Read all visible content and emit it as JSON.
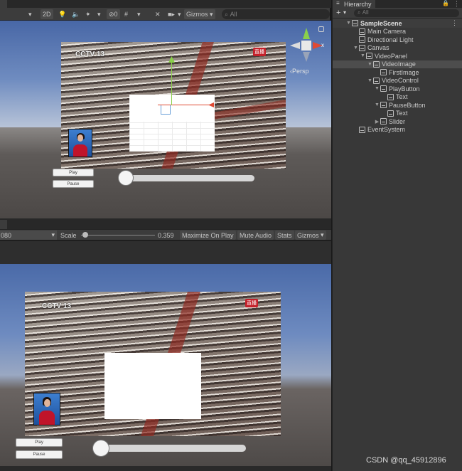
{
  "scene_toolbar": {
    "mode_2d": "2D",
    "hidden_count": "0",
    "gizmos": "Gizmos",
    "search_placeholder": "All"
  },
  "scene_view": {
    "persp_label": "‹Persp",
    "gizmo_axis_x": "x"
  },
  "video": {
    "channel_logo": "CCTV 13",
    "live_badge": "直播"
  },
  "controls": {
    "play_label": "Play",
    "pause_label": "Pause"
  },
  "game_toolbar": {
    "resolution_value": "080",
    "scale_label": "Scale",
    "scale_value": "0.359",
    "scale_level": 0.06,
    "maximize_on_play": "Maximize On Play",
    "mute_audio": "Mute Audio",
    "stats": "Stats",
    "gizmos": "Gizmos"
  },
  "hierarchy": {
    "tab_label": "Hierarchy",
    "search_placeholder": "All",
    "items": [
      {
        "label": "SampleScene",
        "depth": 0,
        "arrow": "▼",
        "bold": true
      },
      {
        "label": "Main Camera",
        "depth": 1,
        "arrow": ""
      },
      {
        "label": "Directional Light",
        "depth": 1,
        "arrow": ""
      },
      {
        "label": "Canvas",
        "depth": 1,
        "arrow": "▼"
      },
      {
        "label": "VideoPanel",
        "depth": 2,
        "arrow": "▼"
      },
      {
        "label": "VideoImage",
        "depth": 3,
        "arrow": "▼",
        "selected": true
      },
      {
        "label": "FirstImage",
        "depth": 4,
        "arrow": ""
      },
      {
        "label": "VideoControl",
        "depth": 3,
        "arrow": "▼"
      },
      {
        "label": "PlayButton",
        "depth": 4,
        "arrow": "▼"
      },
      {
        "label": "Text",
        "depth": 5,
        "arrow": ""
      },
      {
        "label": "PauseButton",
        "depth": 4,
        "arrow": "▼"
      },
      {
        "label": "Text",
        "depth": 5,
        "arrow": ""
      },
      {
        "label": "Slider",
        "depth": 4,
        "arrow": "▶"
      },
      {
        "label": "EventSystem",
        "depth": 1,
        "arrow": ""
      }
    ]
  },
  "watermark": "CSDN @qq_45912896",
  "colors": {
    "editor_bg": "#383838",
    "sky_top": "#4a6aa8",
    "ground": "#5c5856",
    "live_red": "#c4202a",
    "gizmo_x": "#e04a34",
    "gizmo_y": "#8ad04a"
  }
}
